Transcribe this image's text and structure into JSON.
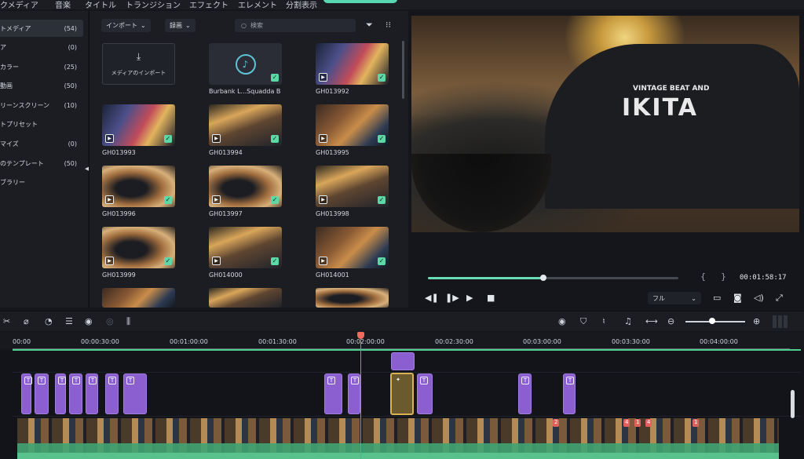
{
  "menu": {
    "tabs": [
      "クメディア",
      "音楽",
      "タイトル",
      "トランジション",
      "エフェクト",
      "エレメント",
      "分割表示"
    ]
  },
  "sidebar": {
    "items": [
      {
        "label": "トメディア",
        "count": "(54)",
        "active": true
      },
      {
        "label": "ア",
        "count": "(0)"
      },
      {
        "label": "カラー",
        "count": "(25)"
      },
      {
        "label": "動画",
        "count": "(50)"
      },
      {
        "label": "リーンスクリーン",
        "count": "(10)"
      },
      {
        "label": "トプリセット",
        "count": ""
      },
      {
        "label": "マイズ",
        "count": "(0)"
      },
      {
        "label": "のテンプレート",
        "count": "(50)"
      },
      {
        "label": "ブラリー",
        "count": ""
      }
    ]
  },
  "media": {
    "import_dropdown": "インポート",
    "record_dropdown": "録画",
    "search_placeholder": "検索",
    "import_tile_label": "メディアのインポート",
    "items": [
      {
        "name": "Burbank L...Squadda B",
        "kind": "audio"
      },
      {
        "name": "GH013992",
        "kind": "video"
      },
      {
        "name": "GH013993",
        "kind": "video"
      },
      {
        "name": "GH013994",
        "kind": "video"
      },
      {
        "name": "GH013995",
        "kind": "video"
      },
      {
        "name": "GH013996",
        "kind": "video"
      },
      {
        "name": "GH013997",
        "kind": "video"
      },
      {
        "name": "GH013998",
        "kind": "video"
      },
      {
        "name": "GH013999",
        "kind": "video"
      },
      {
        "name": "GH014000",
        "kind": "video"
      },
      {
        "name": "GH014001",
        "kind": "video"
      }
    ]
  },
  "preview": {
    "timecode": "00:01:58:17",
    "quality": "フル",
    "progress": 0.46,
    "frame_text_small": "VINTAGE BEAT AND",
    "frame_text_large": "IKITA"
  },
  "timeline": {
    "ruler_labels": [
      "00:00",
      "00:00:30:00",
      "00:01:00:00",
      "00:01:30:00",
      "00:02:00:00",
      "00:02:30:00",
      "00:03:00:00",
      "00:03:30:00",
      "00:04:00:00"
    ],
    "zoom_level": 0.45,
    "title_clip_glyph": "T",
    "clip_badges": [
      "2",
      "4",
      "1",
      "4",
      "1"
    ]
  },
  "colors": {
    "accent": "#59d7b0",
    "playhead": "#f06a5e",
    "title_clip": "#8b5fcf",
    "audio_track": "#3fa372"
  }
}
